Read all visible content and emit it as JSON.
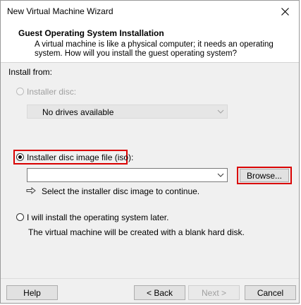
{
  "window": {
    "title": "New Virtual Machine Wizard"
  },
  "header": {
    "title": "Guest Operating System Installation",
    "description": "A virtual machine is like a physical computer; it needs an operating system. How will you install the guest operating system?"
  },
  "install_from": {
    "label": "Install from:",
    "installer_disc": {
      "label": "Installer disc:",
      "selected": false,
      "enabled": false
    },
    "disc_drive_select": {
      "value": "No drives available"
    },
    "iso_option": {
      "label": "Installer disc image file (iso):",
      "selected": true
    },
    "iso_path": {
      "value": ""
    },
    "browse_label": "Browse...",
    "hint": "Select the installer disc image to continue.",
    "later_option": {
      "label": "I will install the operating system later.",
      "selected": false
    },
    "later_desc": "The virtual machine will be created with a blank hard disk."
  },
  "footer": {
    "help": "Help",
    "back": "< Back",
    "next": "Next >",
    "cancel": "Cancel"
  },
  "colors": {
    "highlight": "#d90000",
    "dialog_bg": "#f0f0f0"
  }
}
